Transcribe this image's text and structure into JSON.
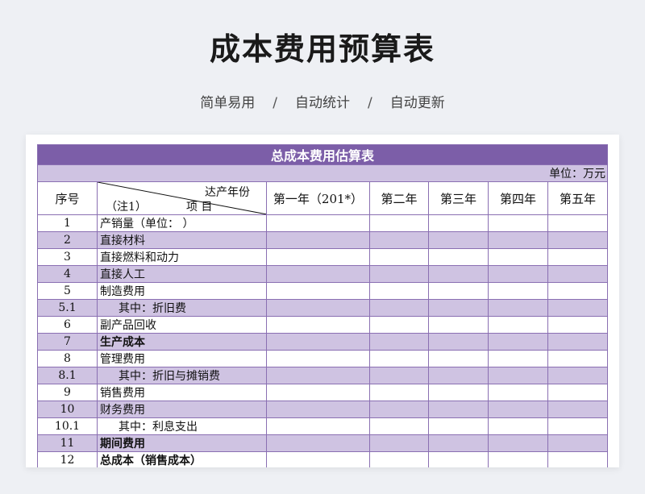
{
  "page": {
    "title": "成本费用预算表",
    "subtitle_parts": [
      "简单易用",
      "/",
      "自动统计",
      "/",
      "自动更新"
    ]
  },
  "table": {
    "title": "总成本费用估算表",
    "unit": "单位：万元",
    "header": {
      "seq": "序号",
      "diag_top": "达产年份",
      "diag_bottom_left": "（注1）",
      "diag_bottom_right": "项 目",
      "years": [
        "第一年（201*）",
        "第二年",
        "第三年",
        "第四年",
        "第五年"
      ]
    },
    "rows": [
      {
        "seq": "1",
        "item": "产销量（单位：    ）",
        "style": "normal"
      },
      {
        "seq": "2",
        "item": "直接材料",
        "style": "normal"
      },
      {
        "seq": "3",
        "item": "直接燃料和动力",
        "style": "normal"
      },
      {
        "seq": "4",
        "item": "直接人工",
        "style": "normal"
      },
      {
        "seq": "5",
        "item": "制造费用",
        "style": "normal"
      },
      {
        "seq": "5.1",
        "item": "其中：折旧费",
        "style": "sub"
      },
      {
        "seq": "6",
        "item": "副产品回收",
        "style": "normal"
      },
      {
        "seq": "7",
        "item": "生产成本",
        "style": "bold"
      },
      {
        "seq": "8",
        "item": "管理费用",
        "style": "normal"
      },
      {
        "seq": "8.1",
        "item": "其中：折旧与摊销费",
        "style": "sub"
      },
      {
        "seq": "9",
        "item": "销售费用",
        "style": "normal"
      },
      {
        "seq": "10",
        "item": "财务费用",
        "style": "normal"
      },
      {
        "seq": "10.1",
        "item": "其中：利息支出",
        "style": "sub"
      },
      {
        "seq": "11",
        "item": "期间费用",
        "style": "bold"
      },
      {
        "seq": "12",
        "item": "总成本（销售成本）",
        "style": "bold"
      }
    ]
  }
}
